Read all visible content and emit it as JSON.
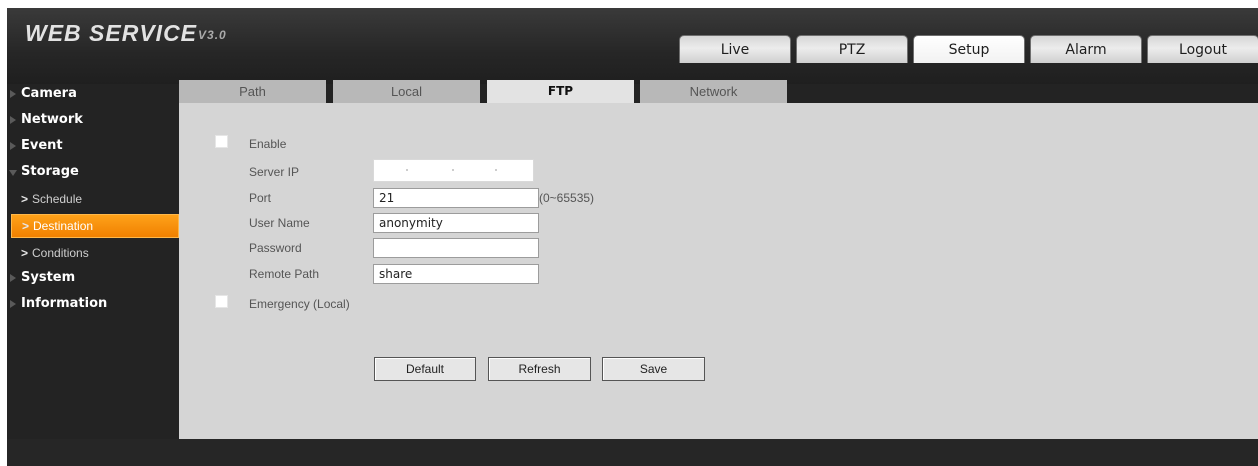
{
  "app": {
    "logo": "WEB SERVICE",
    "version": "V3.0"
  },
  "topnav": [
    "Live",
    "PTZ",
    "Setup",
    "Alarm",
    "Logout"
  ],
  "topnav_active": "Setup",
  "sidebar": {
    "items": [
      {
        "label": "Camera"
      },
      {
        "label": "Network"
      },
      {
        "label": "Event"
      },
      {
        "label": "Storage",
        "expanded": true,
        "children": [
          "Schedule",
          "Destination",
          "Conditions"
        ]
      },
      {
        "label": "System"
      },
      {
        "label": "Information"
      }
    ],
    "active_child": "Destination"
  },
  "tabs": [
    "Path",
    "Local",
    "FTP",
    "Network"
  ],
  "active_tab": "FTP",
  "form": {
    "enable_label": "Enable",
    "server_ip_label": "Server IP",
    "port_label": "Port",
    "port_value": "21",
    "port_hint": "(0~65535)",
    "username_label": "User Name",
    "username_value": "anonymity",
    "password_label": "Password",
    "password_value": "",
    "remote_path_label": "Remote Path",
    "remote_path_value": "share",
    "emergency_label": "Emergency (Local)"
  },
  "buttons": {
    "default": "Default",
    "refresh": "Refresh",
    "save": "Save"
  },
  "colors": {
    "accent": "#f39400",
    "background": "#232323",
    "panel": "#d5d5d5"
  },
  "icons": {
    "menu_arrow": "triangle-right-icon",
    "menu_arrow_expanded": "triangle-down-icon",
    "sub_item": "chevron-right-icon"
  }
}
